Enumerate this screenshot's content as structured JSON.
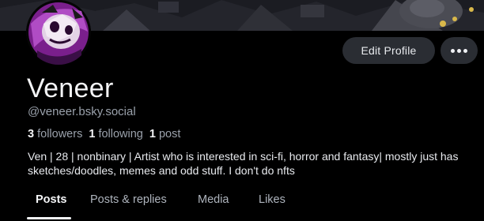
{
  "profile": {
    "display_name": "Veneer",
    "handle": "@veneer.bsky.social",
    "followers_count": "3",
    "followers_label": "followers",
    "following_count": "1",
    "following_label": "following",
    "posts_count": "1",
    "posts_label": "post",
    "bio": "Ven | 28 | nonbinary | Artist who is interested in sci-fi, horror and fantasy| mostly just has sketches/doodles, memes and odd stuff. I don't do nfts"
  },
  "actions": {
    "edit_label": "Edit Profile",
    "more_icon": "ellipsis-icon"
  },
  "tabs": [
    {
      "label": "Posts",
      "active": true
    },
    {
      "label": "Posts & replies",
      "active": false
    },
    {
      "label": "Media",
      "active": false
    },
    {
      "label": "Likes",
      "active": false
    }
  ],
  "colors": {
    "background": "#000000",
    "button_bg": "#2a2d33",
    "muted_text": "#9aa1ab"
  }
}
